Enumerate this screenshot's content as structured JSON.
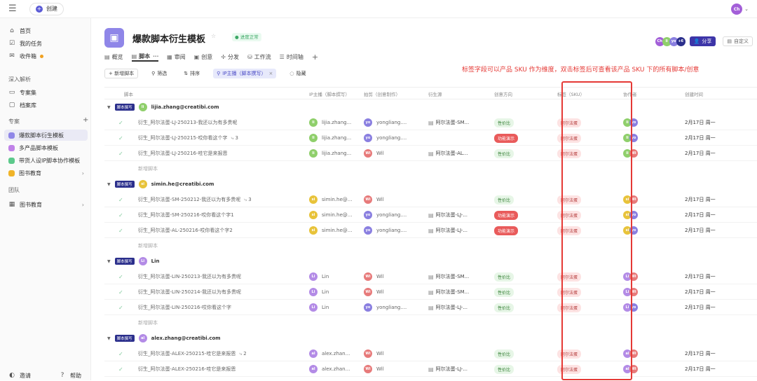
{
  "topbar": {
    "menu_icon": "☰",
    "create_label": "创建",
    "user_initials": "Ch"
  },
  "sidebar": {
    "items_top": [
      {
        "label": "首页",
        "icon": "⌂"
      },
      {
        "label": "我的任务",
        "icon": "☑"
      },
      {
        "label": "收件箱",
        "icon": "✉"
      }
    ],
    "section_analysis": "深入解析",
    "analysis_items": [
      {
        "label": "专案集",
        "icon": "▭"
      },
      {
        "label": "档案库",
        "icon": "▢"
      }
    ],
    "section_projects": "专案",
    "add_icon": "+",
    "projects": [
      {
        "label": "爆款脚本衍生模板",
        "color": "#8f86e8"
      },
      {
        "label": "多产品脚本模板",
        "color": "#c082e8"
      },
      {
        "label": "带货人设IP脚本协作模板",
        "color": "#5cc98b"
      },
      {
        "label": "图书教育",
        "color": "#f0b429"
      }
    ],
    "section_team": "团队",
    "team_items": [
      {
        "label": "图书教育",
        "icon": "▦"
      }
    ],
    "invite_label": "邀请",
    "help_label": "帮助"
  },
  "project": {
    "title": "爆款脚本衍生模板",
    "status": "● 进度正常",
    "share_label": "分享",
    "custom_label": "自定义",
    "member_count": "+6"
  },
  "tabs": [
    {
      "label": "概览",
      "icon": "▤"
    },
    {
      "label": "脚本",
      "icon": "▤"
    },
    {
      "label": "审阅",
      "icon": "▦"
    },
    {
      "label": "创意",
      "icon": "▣"
    },
    {
      "label": "分发",
      "icon": "✢"
    },
    {
      "label": "工作流",
      "icon": "⛁"
    },
    {
      "label": "时间轴",
      "icon": "☰"
    }
  ],
  "toolbar": {
    "add_label": "+ 新增脚本",
    "filter_label": "筛选",
    "sort_label": "排序",
    "active_filter": "IP主播（脚本撰写）",
    "hide_label": "隐藏"
  },
  "annotation": "标签字段可以产品 SKU 作为维度，双击标签后可查看该产品 SKU 下的所有脚本/创意",
  "columns": [
    "脚本",
    "IP主播（脚本撰写）",
    "拍剪（创意制作）",
    "衍生源",
    "创意方向",
    "标签（SKU）",
    "协作者",
    "创建时间"
  ],
  "group_tag": "脚本撰写",
  "new_row_label": "新增脚本",
  "groups": [
    {
      "owner": "lijia.zhang@creatibi.com",
      "owner_initials": "li",
      "owner_color": "#8fcf6b",
      "rows": [
        {
          "name": "衍生_阿尔法蛋-LJ-250213-我还以为有多贵呢",
          "sub": "",
          "ip": "lijia.zhang...",
          "ip_initials": "li",
          "ip_color": "#8fcf6b",
          "editor": "yongliang....",
          "ed_initials": "yo",
          "ed_color": "#8a7fe0",
          "source": "阿尔法蛋-SM...",
          "direction": "性价比",
          "dir_red": false,
          "sku": "阿尔法蛋",
          "date": "2月17日 周一"
        },
        {
          "name": "衍生_阿尔法蛋-LJ-250215-哎你看这个字",
          "sub": "3",
          "ip": "lijia.zhang...",
          "ip_initials": "li",
          "ip_color": "#8fcf6b",
          "editor": "yongliang....",
          "ed_initials": "yo",
          "ed_color": "#8a7fe0",
          "source": "",
          "direction": "功能演示",
          "dir_red": true,
          "sku": "阿尔法蛋",
          "date": "2月17日 周一"
        },
        {
          "name": "衍生_阿尔法蛋-LJ-250216-哇它是来报恩",
          "sub": "",
          "ip": "lijia.zhang...",
          "ip_initials": "li",
          "ip_color": "#8fcf6b",
          "editor": "Wil",
          "ed_initials": "Wi",
          "ed_color": "#e77a7a",
          "source": "阿尔法蛋-AL...",
          "direction": "性价比",
          "dir_red": false,
          "sku": "阿尔法蛋",
          "date": "2月17日 周一"
        }
      ]
    },
    {
      "owner": "simin.he@creatibi.com",
      "owner_initials": "si",
      "owner_color": "#e8c33a",
      "rows": [
        {
          "name": "衍生_阿尔法蛋-SM-250212-我还以为有多贵呢",
          "sub": "3",
          "ip": "simin.he@...",
          "ip_initials": "si",
          "ip_color": "#e8c33a",
          "editor": "Wil",
          "ed_initials": "Wi",
          "ed_color": "#e77a7a",
          "source": "",
          "direction": "性价比",
          "dir_red": false,
          "sku": "阿尔法蛋",
          "date": "2月17日 周一"
        },
        {
          "name": "衍生_阿尔法蛋-SM-250216-哎你看这个字1",
          "sub": "",
          "ip": "simin.he@...",
          "ip_initials": "si",
          "ip_color": "#e8c33a",
          "editor": "yongliang....",
          "ed_initials": "yo",
          "ed_color": "#8a7fe0",
          "source": "阿尔法蛋-LJ-...",
          "direction": "功能演示",
          "dir_red": true,
          "sku": "阿尔法蛋",
          "date": "2月17日 周一"
        },
        {
          "name": "衍生_阿尔法蛋-AL-250216-哎你看这个字2",
          "sub": "",
          "ip": "simin.he@...",
          "ip_initials": "si",
          "ip_color": "#e8c33a",
          "editor": "yongliang....",
          "ed_initials": "yo",
          "ed_color": "#8a7fe0",
          "source": "阿尔法蛋-LJ-...",
          "direction": "功能演示",
          "dir_red": true,
          "sku": "阿尔法蛋",
          "date": "2月17日 周一"
        }
      ]
    },
    {
      "owner": "Lin",
      "owner_initials": "Li",
      "owner_color": "#b38be6",
      "rows": [
        {
          "name": "衍生_阿尔法蛋-LIN-250213-我还以为有多贵呢",
          "sub": "",
          "ip": "Lin",
          "ip_initials": "Li",
          "ip_color": "#b38be6",
          "editor": "Wil",
          "ed_initials": "Wi",
          "ed_color": "#e77a7a",
          "source": "阿尔法蛋-SM...",
          "direction": "性价比",
          "dir_red": false,
          "sku": "阿尔法蛋",
          "date": "2月17日 周一"
        },
        {
          "name": "衍生_阿尔法蛋-LIN-250214-我还以为有多贵呢",
          "sub": "",
          "ip": "Lin",
          "ip_initials": "Li",
          "ip_color": "#b38be6",
          "editor": "Wil",
          "ed_initials": "Wi",
          "ed_color": "#e77a7a",
          "source": "阿尔法蛋-SM...",
          "direction": "性价比",
          "dir_red": false,
          "sku": "阿尔法蛋",
          "date": "2月17日 周一"
        },
        {
          "name": "衍生_阿尔法蛋-LIN-250216-哎你看这个字",
          "sub": "",
          "ip": "Lin",
          "ip_initials": "Li",
          "ip_color": "#b38be6",
          "editor": "yongliang....",
          "ed_initials": "yo",
          "ed_color": "#8a7fe0",
          "source": "阿尔法蛋-LJ-...",
          "direction": "性价比",
          "dir_red": false,
          "sku": "阿尔法蛋",
          "date": "2月17日 周一"
        }
      ]
    },
    {
      "owner": "alex.zhang@creatibi.com",
      "owner_initials": "al",
      "owner_color": "#b38be6",
      "rows": [
        {
          "name": "衍生_阿尔法蛋-ALEX-250215-哇它是来报恩",
          "sub": "2",
          "ip": "alex.zhan...",
          "ip_initials": "al",
          "ip_color": "#b38be6",
          "editor": "Wil",
          "ed_initials": "Wi",
          "ed_color": "#e77a7a",
          "source": "",
          "direction": "性价比",
          "dir_red": false,
          "sku": "阿尔法蛋",
          "date": "2月17日 周一"
        },
        {
          "name": "衍生_阿尔法蛋-ALEX-250216-哇它是来报恩",
          "sub": "",
          "ip": "alex.zhan...",
          "ip_initials": "al",
          "ip_color": "#b38be6",
          "editor": "Wil",
          "ed_initials": "Wi",
          "ed_color": "#e77a7a",
          "source": "阿尔法蛋-LJ-...",
          "direction": "性价比",
          "dir_red": false,
          "sku": "阿尔法蛋",
          "date": "2月17日 周一"
        }
      ]
    }
  ]
}
